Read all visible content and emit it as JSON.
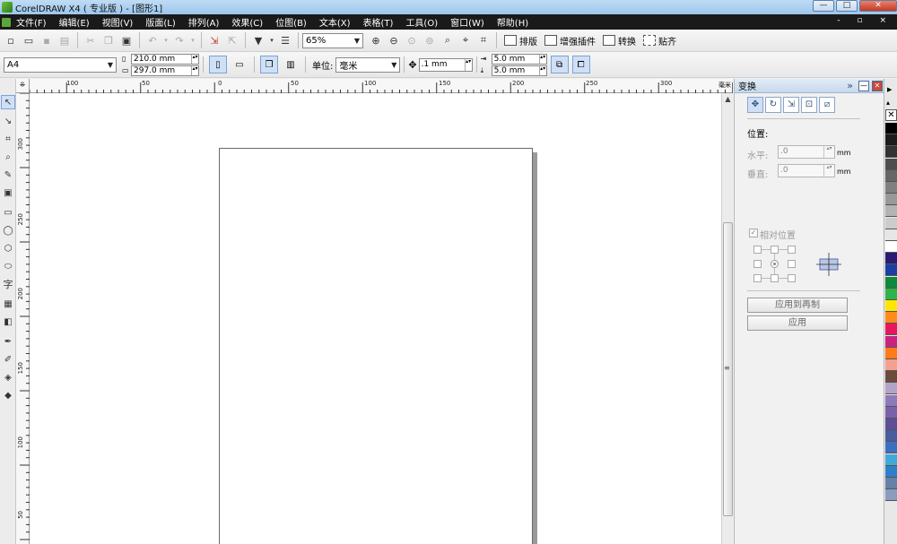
{
  "window": {
    "title": "CorelDRAW X4 ( 专业版 ) - [图形1]",
    "buttons": {
      "minimize": "—",
      "maximize": "□",
      "close": "✕"
    }
  },
  "menu": {
    "items": [
      "文件(F)",
      "编辑(E)",
      "视图(V)",
      "版面(L)",
      "排列(A)",
      "效果(C)",
      "位图(B)",
      "文本(X)",
      "表格(T)",
      "工具(O)",
      "窗口(W)",
      "帮助(H)"
    ],
    "mdi_controls": "- ▫ ×"
  },
  "standard_toolbar": {
    "zoom": "65%",
    "buttons": [
      "排版",
      "增强插件",
      "转换",
      "贴齐"
    ]
  },
  "property_bar": {
    "paper_size": "A4",
    "width": "210.0 mm",
    "height": "297.0 mm",
    "units_label": "单位:",
    "units": "毫米",
    "nudge": ".1 mm",
    "dup_x": "5.0 mm",
    "dup_y": "5.0 mm"
  },
  "rulers": {
    "top_labels": [
      "100",
      "50",
      "0",
      "50",
      "100",
      "150",
      "200",
      "250",
      "300"
    ],
    "left_labels": [
      "300",
      "250",
      "200",
      "150",
      "100",
      "50"
    ],
    "unit": "毫米"
  },
  "docker": {
    "title": "变换",
    "section": "位置:",
    "horizontal_label": "水平:",
    "vertical_label": "垂直:",
    "horizontal_value": ".0",
    "vertical_value": ".0",
    "unit": "mm",
    "relative_label": "相对位置",
    "apply_to_duplicate": "应用到再制",
    "apply": "应用"
  },
  "palette": {
    "colors": [
      "#e8e8e8",
      "#ffffff",
      "#000000",
      "#1c1c1c",
      "#333333",
      "#4d4d4d",
      "#666666",
      "#808080",
      "#999999",
      "#b3b3b3",
      "#cccccc",
      "#e6e6e6",
      "#ffffff",
      "#2b1a72",
      "#1a3fa3",
      "#0f8a3c",
      "#2fb34b",
      "#ffe600",
      "#ff8c1a",
      "#e8175d",
      "#c8247f",
      "#ff7a1a",
      "#f4a090",
      "#6b4c3b",
      "#b3a2c9",
      "#8c7bb8",
      "#7a62a8",
      "#5e4e96",
      "#4a5ca0",
      "#3d6fc0",
      "#42a8d8",
      "#2f7ec8",
      "#6680a8",
      "#8a9cbc"
    ]
  }
}
